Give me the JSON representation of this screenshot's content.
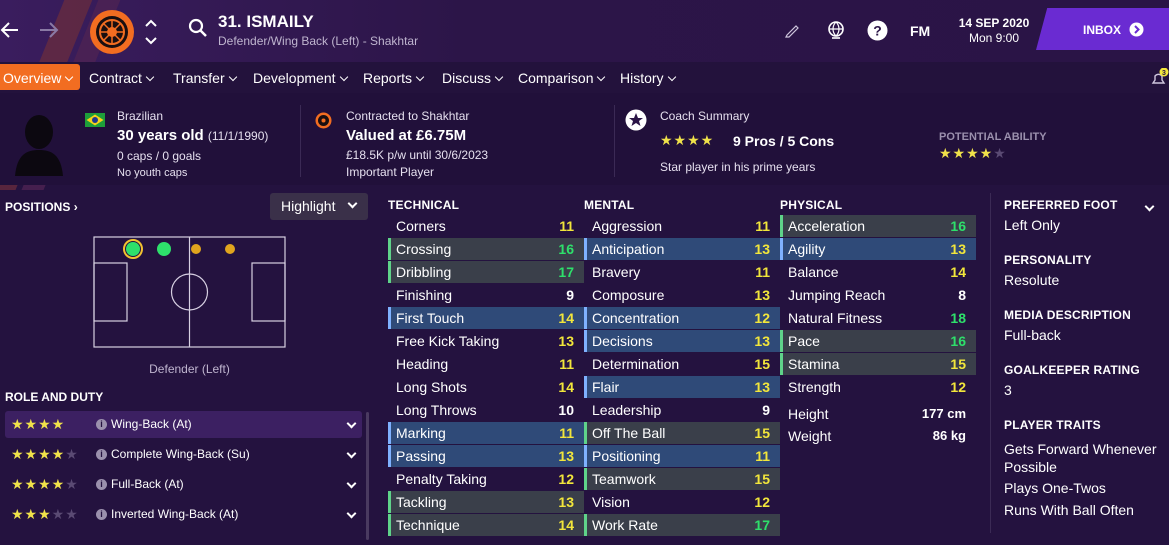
{
  "header": {
    "player_name": "31. ISMAILY",
    "subtitle": "Defender/Wing Back (Left) - Shakhtar",
    "brand": "FM",
    "date": "14 SEP 2020",
    "time": "Mon 9:00",
    "inbox_label": "INBOX",
    "notification_count": "3"
  },
  "tabs": [
    {
      "label": "Overview"
    },
    {
      "label": "Contract"
    },
    {
      "label": "Transfer"
    },
    {
      "label": "Development"
    },
    {
      "label": "Reports"
    },
    {
      "label": "Discuss"
    },
    {
      "label": "Comparison"
    },
    {
      "label": "History"
    }
  ],
  "info": {
    "nationality": "Brazilian",
    "age": "30 years old",
    "dob": "(11/1/1990)",
    "caps": "0 caps / 0 goals",
    "youth_caps": "No youth caps",
    "contracted_to": "Contracted to Shakhtar",
    "value": "Valued at £6.75M",
    "wage": "£18.5K p/w until 30/6/2023",
    "squad_status": "Important Player",
    "coach_title": "Coach Summary",
    "coach_stars": 4,
    "pros_cons": "9 Pros / 5 Cons",
    "coach_note": "Star player in his prime years",
    "potential_label": "POTENTIAL ABILITY",
    "potential_stars": 4
  },
  "positions": {
    "title": "POSITIONS",
    "highlight_label": "Highlight",
    "position_label": "Defender (Left)"
  },
  "roles": {
    "title": "ROLE AND DUTY",
    "items": [
      {
        "label": "Wing-Back (At)",
        "stars": 4
      },
      {
        "label": "Complete Wing-Back (Su)",
        "stars": 4
      },
      {
        "label": "Full-Back (At)",
        "stars": 4
      },
      {
        "label": "Inverted Wing-Back (At)",
        "stars": 3
      }
    ]
  },
  "colors": {
    "yellow": "#f2e63b",
    "white": "#ffffff",
    "green": "#2ee06b",
    "highlight_blue": "#2f4a78",
    "highlight_grey": "#3a3f4a",
    "bar_blue": "#7fb1ff",
    "bar_green": "#5fd38a"
  },
  "technical": {
    "title": "TECHNICAL",
    "rows": [
      {
        "name": "Corners",
        "value": "11",
        "tone": "y",
        "hl": ""
      },
      {
        "name": "Crossing",
        "value": "16",
        "tone": "g",
        "hl": "grey"
      },
      {
        "name": "Dribbling",
        "value": "17",
        "tone": "g",
        "hl": "grey"
      },
      {
        "name": "Finishing",
        "value": "9",
        "tone": "w",
        "hl": ""
      },
      {
        "name": "First Touch",
        "value": "14",
        "tone": "y",
        "hl": "blue"
      },
      {
        "name": "Free Kick Taking",
        "value": "13",
        "tone": "y",
        "hl": ""
      },
      {
        "name": "Heading",
        "value": "11",
        "tone": "y",
        "hl": ""
      },
      {
        "name": "Long Shots",
        "value": "14",
        "tone": "y",
        "hl": ""
      },
      {
        "name": "Long Throws",
        "value": "10",
        "tone": "w",
        "hl": ""
      },
      {
        "name": "Marking",
        "value": "11",
        "tone": "y",
        "hl": "blue"
      },
      {
        "name": "Passing",
        "value": "13",
        "tone": "y",
        "hl": "blue"
      },
      {
        "name": "Penalty Taking",
        "value": "12",
        "tone": "y",
        "hl": ""
      },
      {
        "name": "Tackling",
        "value": "13",
        "tone": "y",
        "hl": "grey"
      },
      {
        "name": "Technique",
        "value": "14",
        "tone": "y",
        "hl": "grey"
      }
    ]
  },
  "mental": {
    "title": "MENTAL",
    "rows": [
      {
        "name": "Aggression",
        "value": "11",
        "tone": "y",
        "hl": ""
      },
      {
        "name": "Anticipation",
        "value": "13",
        "tone": "y",
        "hl": "blue"
      },
      {
        "name": "Bravery",
        "value": "11",
        "tone": "y",
        "hl": ""
      },
      {
        "name": "Composure",
        "value": "13",
        "tone": "y",
        "hl": ""
      },
      {
        "name": "Concentration",
        "value": "12",
        "tone": "y",
        "hl": "blue"
      },
      {
        "name": "Decisions",
        "value": "13",
        "tone": "y",
        "hl": "blue"
      },
      {
        "name": "Determination",
        "value": "15",
        "tone": "y",
        "hl": ""
      },
      {
        "name": "Flair",
        "value": "13",
        "tone": "y",
        "hl": "blue"
      },
      {
        "name": "Leadership",
        "value": "9",
        "tone": "w",
        "hl": ""
      },
      {
        "name": "Off The Ball",
        "value": "15",
        "tone": "y",
        "hl": "grey"
      },
      {
        "name": "Positioning",
        "value": "11",
        "tone": "y",
        "hl": "blue"
      },
      {
        "name": "Teamwork",
        "value": "15",
        "tone": "y",
        "hl": "grey"
      },
      {
        "name": "Vision",
        "value": "12",
        "tone": "y",
        "hl": ""
      },
      {
        "name": "Work Rate",
        "value": "17",
        "tone": "g",
        "hl": "grey"
      }
    ]
  },
  "physical": {
    "title": "PHYSICAL",
    "rows": [
      {
        "name": "Acceleration",
        "value": "16",
        "tone": "g",
        "hl": "grey"
      },
      {
        "name": "Agility",
        "value": "13",
        "tone": "y",
        "hl": "blue"
      },
      {
        "name": "Balance",
        "value": "14",
        "tone": "y",
        "hl": ""
      },
      {
        "name": "Jumping Reach",
        "value": "8",
        "tone": "w",
        "hl": ""
      },
      {
        "name": "Natural Fitness",
        "value": "18",
        "tone": "g",
        "hl": ""
      },
      {
        "name": "Pace",
        "value": "16",
        "tone": "g",
        "hl": "grey"
      },
      {
        "name": "Stamina",
        "value": "15",
        "tone": "y",
        "hl": "grey"
      },
      {
        "name": "Strength",
        "value": "12",
        "tone": "y",
        "hl": ""
      }
    ],
    "height_label": "Height",
    "height_value": "177 cm",
    "weight_label": "Weight",
    "weight_value": "86 kg"
  },
  "sidebar": [
    {
      "title": "PREFERRED FOOT",
      "value": "Left Only"
    },
    {
      "title": "PERSONALITY",
      "value": "Resolute"
    },
    {
      "title": "MEDIA DESCRIPTION",
      "value": "Full-back"
    },
    {
      "title": "GOALKEEPER RATING",
      "value": "3"
    }
  ],
  "traits": {
    "title": "PLAYER TRAITS",
    "items": [
      "Gets Forward Whenever Possible",
      "Plays One-Twos",
      "Runs With Ball Often"
    ]
  }
}
